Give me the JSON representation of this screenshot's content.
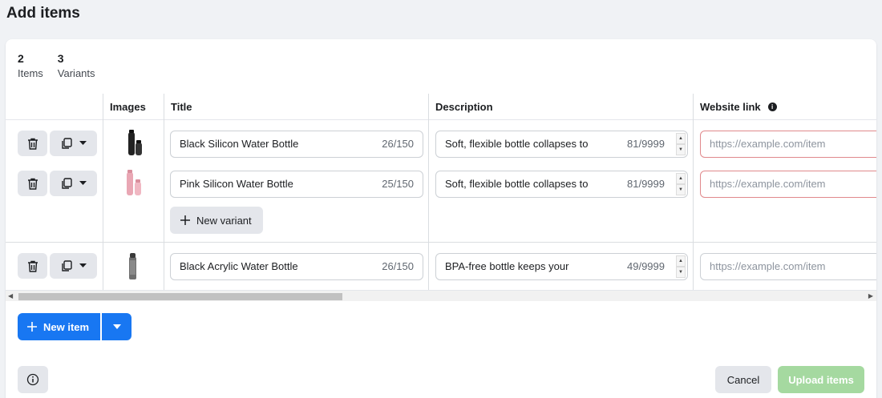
{
  "page": {
    "title": "Add items"
  },
  "stats": {
    "items_count": "2",
    "items_label": "Items",
    "variants_count": "3",
    "variants_label": "Variants"
  },
  "table": {
    "columns": [
      "Images",
      "Title",
      "Description",
      "Website link"
    ],
    "rows": [
      {
        "title": "Black Silicon Water Bottle",
        "title_count": "26/150",
        "description": "Soft, flexible bottle collapses to",
        "description_count": "81/9999",
        "link_placeholder": "https://example.com/item",
        "image_icon": "black-bottle-thumbnail"
      },
      {
        "title": "Pink Silicon Water Bottle",
        "title_count": "25/150",
        "description": "Soft, flexible bottle collapses to",
        "description_count": "81/9999",
        "link_placeholder": "https://example.com/item",
        "image_icon": "pink-bottle-thumbnail"
      },
      {
        "title": "Black Acrylic Water Bottle",
        "title_count": "26/150",
        "description": "BPA-free bottle keeps your",
        "description_count": "49/9999",
        "link_placeholder": "https://example.com/item",
        "image_icon": "grey-bottle-thumbnail"
      }
    ],
    "new_variant_label": "New variant"
  },
  "actions": {
    "new_item_label": "New item",
    "cancel_label": "Cancel",
    "upload_label": "Upload items"
  },
  "colors": {
    "primary": "#1877f2",
    "upload_disabled": "#a5d9a0",
    "error_border": "#e0898c"
  }
}
